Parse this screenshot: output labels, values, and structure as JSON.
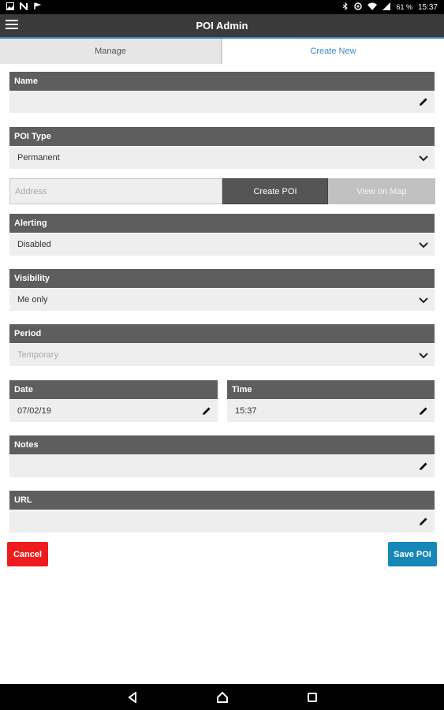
{
  "statusbar": {
    "notification_icons": [
      "image-icon",
      "n-icon",
      "flag-icon"
    ],
    "system_icons": [
      "bluetooth-icon",
      "data-saver-icon",
      "wifi-icon",
      "signal-icon"
    ],
    "battery": "61 %",
    "time": "15:37"
  },
  "appbar": {
    "title": "POI Admin"
  },
  "tabs": [
    {
      "label": "Manage",
      "active": false
    },
    {
      "label": "Create New",
      "active": true
    }
  ],
  "form": {
    "name": {
      "label": "Name",
      "value": ""
    },
    "poi_type": {
      "label": "POI Type",
      "value": "Permanent"
    },
    "address": {
      "placeholder": "Address",
      "create_label": "Create POI",
      "view_label": "View on Map"
    },
    "alerting": {
      "label": "Alerting",
      "value": "Disabled"
    },
    "visibility": {
      "label": "Visibility",
      "value": "Me only"
    },
    "period": {
      "label": "Period",
      "value": "Temporary"
    },
    "date": {
      "label": "Date",
      "value": "07/02/19"
    },
    "time": {
      "label": "Time",
      "value": "15:37"
    },
    "notes": {
      "label": "Notes",
      "value": ""
    },
    "url": {
      "label": "URL",
      "value": ""
    }
  },
  "actions": {
    "cancel_label": "Cancel",
    "save_label": "Save POI"
  },
  "colors": {
    "accent": "#3b86c7",
    "section_header": "#5e5e5e",
    "cancel": "#ee1c1c",
    "save": "#1787b8"
  }
}
